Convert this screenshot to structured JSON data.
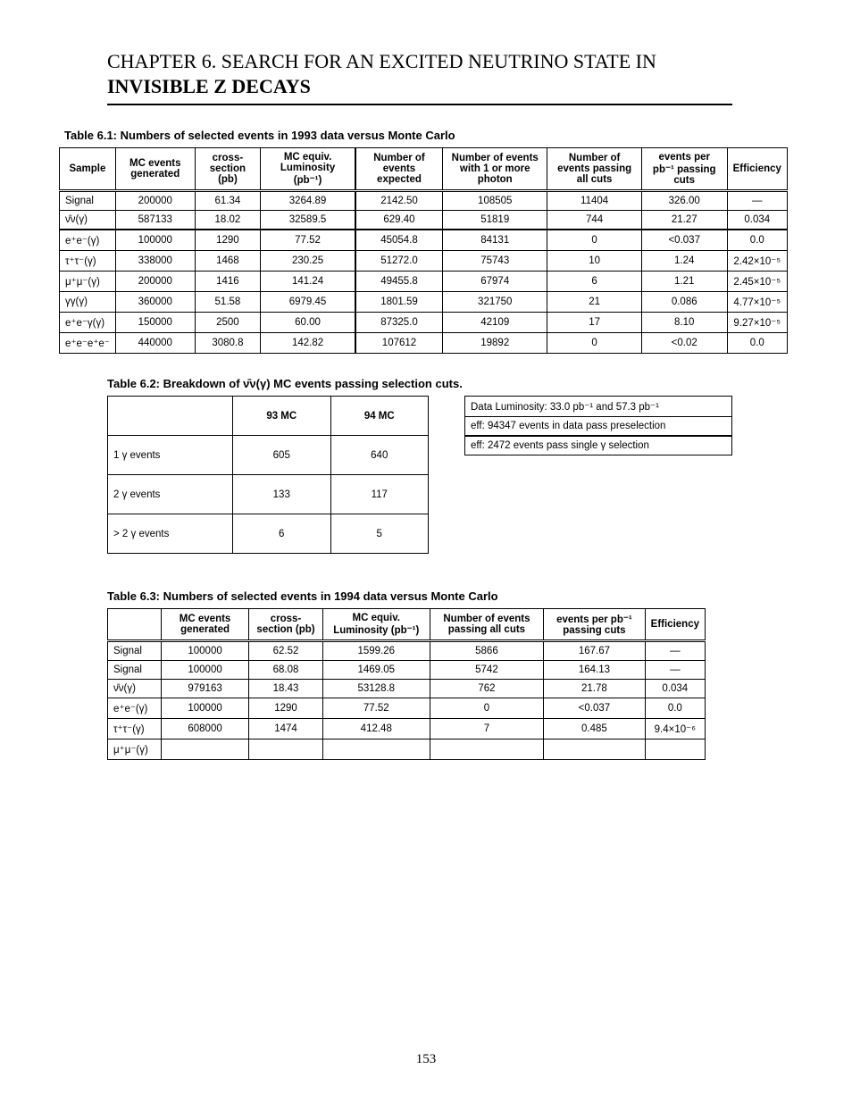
{
  "header": {
    "line1": "CHAPTER 6. SEARCH FOR AN EXCITED NEUTRINO STATE IN",
    "line2": "INVISIBLE Z DECAYS"
  },
  "table61": {
    "title": "Table 6.1: Numbers of selected events in 1993 data versus Monte Carlo",
    "columns": [
      "Sample",
      "MC events generated",
      "cross-section    (pb)",
      "MC equiv. Luminosity (pb⁻¹)",
      "Number of events expected",
      "Number of events with 1 or more photon",
      "Number of events passing all cuts",
      "events per pb⁻¹ passing cuts",
      "Efficiency"
    ],
    "rows": [
      {
        "label": "Signal",
        "gen": "200000",
        "xs": "61.34",
        "lumi": "3264.89",
        "exp": "2142.50",
        "gamma": "108505",
        "pass": "11404",
        "perpb": "326.00",
        "eff": "—"
      },
      {
        "label": "ν̄ν(γ)",
        "gen": "587133",
        "xs": "18.02",
        "lumi": "32589.5",
        "exp": "629.40",
        "gamma": "51819",
        "pass": "744",
        "perpb": "21.27",
        "eff": "0.034"
      },
      {
        "label": "e⁺e⁻(γ)",
        "gen": "100000",
        "xs": "1290",
        "lumi": "77.52",
        "exp": "45054.8",
        "gamma": "84131",
        "pass": "0",
        "perpb": "<0.037",
        "eff": "0.0"
      },
      {
        "label": "τ⁺τ⁻(γ)",
        "gen": "338000",
        "xs": "1468",
        "lumi": "230.25",
        "exp": "51272.0",
        "gamma": "75743",
        "pass": "10",
        "perpb": "1.24",
        "eff": "2.42×10⁻⁵"
      },
      {
        "label": "μ⁺μ⁻(γ)",
        "gen": "200000",
        "xs": "1416",
        "lumi": "141.24",
        "exp": "49455.8",
        "gamma": "67974",
        "pass": "6",
        "perpb": "1.21",
        "eff": "2.45×10⁻⁵"
      },
      {
        "label": "γγ(γ)",
        "gen": "360000",
        "xs": "51.58",
        "lumi": "6979.45",
        "exp": "1801.59",
        "gamma": "321750",
        "pass": "21",
        "perpb": "0.086",
        "eff": "4.77×10⁻⁵"
      },
      {
        "label": "e⁺e⁻γ(γ)",
        "gen": "150000",
        "xs": "2500",
        "lumi": "60.00",
        "exp": "87325.0",
        "gamma": "42109",
        "pass": "17",
        "perpb": "8.10",
        "eff": "9.27×10⁻⁵"
      },
      {
        "label": "e⁺e⁻e⁺e⁻",
        "gen": "440000",
        "xs": "3080.8",
        "lumi": "142.82",
        "exp": "107612",
        "gamma": "19892",
        "pass": "0",
        "perpb": "<0.02",
        "eff": "0.0"
      }
    ]
  },
  "table62": {
    "title": "Table 6.2: Breakdown of ν̄ν(γ) MC events passing selection cuts.",
    "columns": [
      "",
      "93 MC",
      "94 MC"
    ],
    "rows": [
      {
        "label": "1 γ events",
        "c1": "605",
        "c2": "640"
      },
      {
        "label": "2 γ events",
        "c1": "133",
        "c2": "117"
      },
      {
        "label": "> 2 γ events",
        "c1": "6",
        "c2": "5"
      }
    ],
    "note": [
      {
        "l": "Data Luminosity: 33.0 pb⁻¹ and 57.3 pb⁻¹"
      },
      {
        "l": "eff: 94347 events in data pass preselection"
      },
      {
        "l": "eff: 2472 events pass single γ selection"
      }
    ]
  },
  "table63": {
    "title": "Table 6.3: Numbers of selected events in 1994 data versus Monte Carlo",
    "columns": [
      "",
      "MC events generated",
      "cross-section (pb)",
      "MC equiv. Luminosity (pb⁻¹)",
      "Number of events passing all cuts",
      "events per pb⁻¹ passing cuts",
      "Efficiency"
    ],
    "rows": [
      {
        "c0": "Signal",
        "c1": "100000",
        "c2": "62.52",
        "c3": "1599.26",
        "c4": "5866",
        "c5": "167.67",
        "c6": "—"
      },
      {
        "c0": "Signal",
        "c1": "100000",
        "c2": "68.08",
        "c3": "1469.05",
        "c4": "5742",
        "c5": "164.13",
        "c6": "—"
      },
      {
        "c0": "ν̄ν(γ)",
        "c1": "979163",
        "c2": "18.43",
        "c3": "53128.8",
        "c4": "762",
        "c5": "21.78",
        "c6": "0.034"
      },
      {
        "c0": "e⁺e⁻(γ)",
        "c1": "100000",
        "c2": "1290",
        "c3": "77.52",
        "c4": "0",
        "c5": "<0.037",
        "c6": "0.0"
      },
      {
        "c0": "τ⁺τ⁻(γ)",
        "c1": "608000",
        "c2": "1474",
        "c3": "412.48",
        "c4": "7",
        "c5": "0.485",
        "c6": "9.4×10⁻⁶"
      },
      {
        "c0": "μ⁺μ⁻(γ)",
        "c1": "",
        "c2": "",
        "c3": "",
        "c4": "",
        "c5": "",
        "c6": ""
      }
    ]
  },
  "page_number": "153"
}
